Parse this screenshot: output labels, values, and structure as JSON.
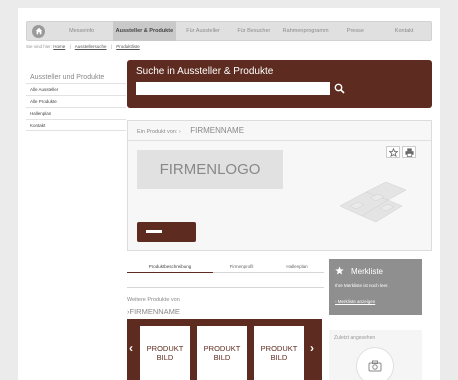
{
  "nav": {
    "items": [
      {
        "label": "Messeinfo",
        "active": false,
        "width": 62
      },
      {
        "label": "Aussteller & Produkte",
        "active": true,
        "width": 64
      },
      {
        "label": "Für Aussteller",
        "active": false,
        "width": 54
      },
      {
        "label": "Für Besucher",
        "active": false,
        "width": 48
      },
      {
        "label": "Rahmenprogramm",
        "active": false,
        "width": 56
      },
      {
        "label": "Presse",
        "active": false,
        "width": 44
      },
      {
        "label": "Kontakt",
        "active": false,
        "width": 54
      }
    ]
  },
  "breadcrumb": {
    "prefix": "Sie sind hier:",
    "items": [
      "Home",
      "Ausstellersuche",
      "Produktliste"
    ]
  },
  "sidebar": {
    "title": "Aussteller und Produkte",
    "items": [
      "Alle Aussteller",
      "Alle Produkte",
      "Hallenplan",
      "Kontakt"
    ]
  },
  "search": {
    "title": "Suche in Aussteller & Produkte",
    "placeholder": ""
  },
  "company": {
    "label": "Ein Produkt von: ›",
    "name": "FIRMENNAME",
    "logo_text": "FIRMENLOGO"
  },
  "tabs": [
    "Produktbeschreibung",
    "Firmenprofil",
    "Hallenplan"
  ],
  "more_products": {
    "label": "Weitere Produkte von",
    "company": "›FIRMENNAME",
    "products": [
      {
        "line1": "PRODUKT",
        "line2": "BILD"
      },
      {
        "line1": "PRODUKT",
        "line2": "BILD"
      },
      {
        "line1": "PRODUKT",
        "line2": "BILD"
      }
    ]
  },
  "merkliste": {
    "title": "Merkliste",
    "empty_text": "Ihre Merkliste ist noch leer.",
    "link": "- Merkliste anzeigen"
  },
  "recent": {
    "title": "Zuletzt angesehen"
  },
  "colors": {
    "accent": "#5d2b1f",
    "merk_bg": "#8f8f8f"
  }
}
